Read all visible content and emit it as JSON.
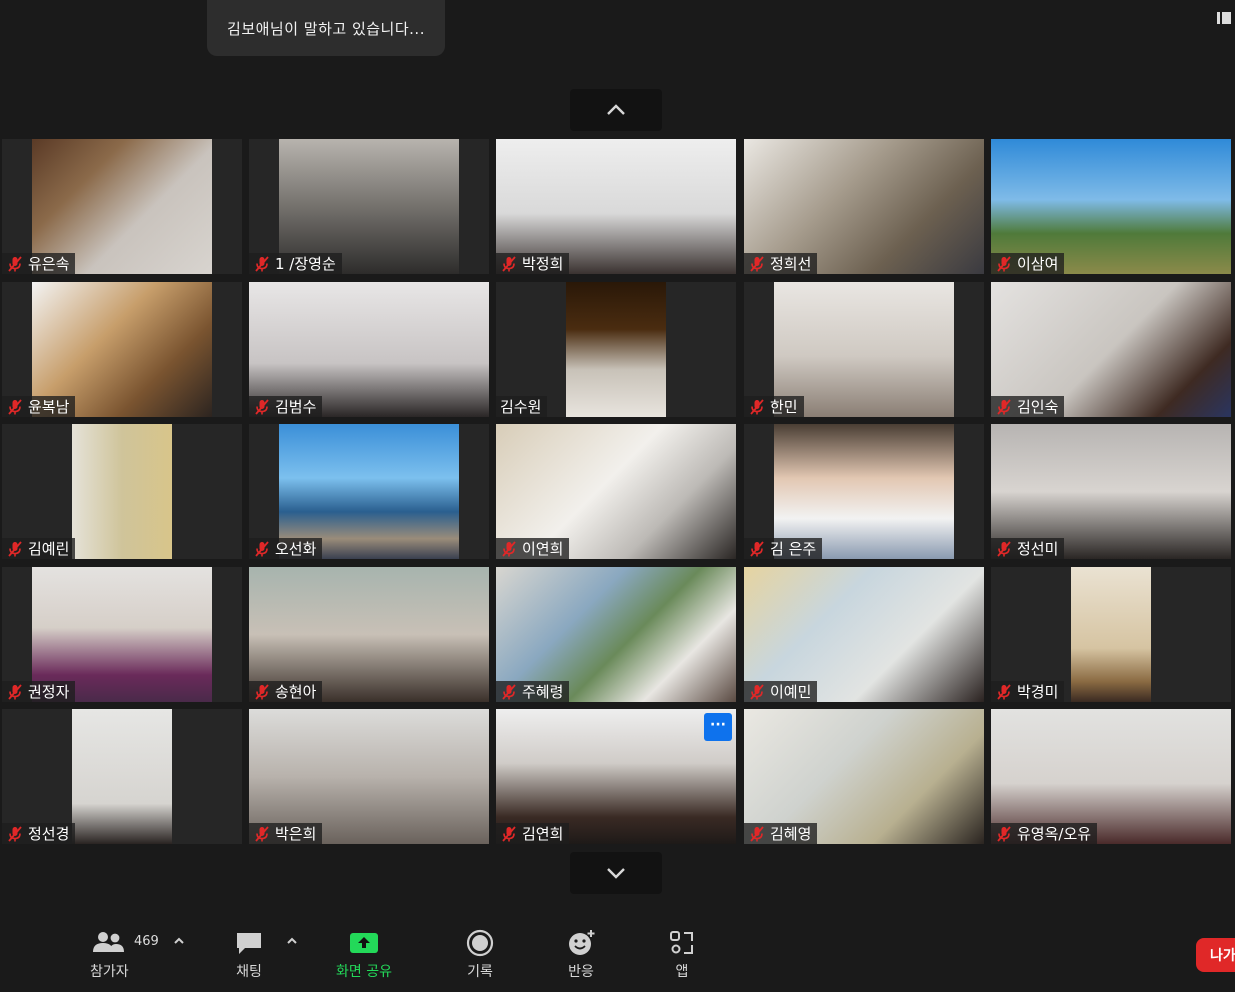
{
  "speaking_banner": "김보애님이 말하고 있습니다...",
  "participants": [
    {
      "name": "유은속",
      "bg": "linear-gradient(135deg,#5a3a26 0%,#8b6a4a 30%,#c9c3bd 60%,#d8d4cf 100%)"
    },
    {
      "name": "1 /장영순",
      "bg": "linear-gradient(180deg,#b8b4ae 0%,#6d6a66 55%,#2d2c2b 100%)"
    },
    {
      "name": "박정희",
      "bg": "linear-gradient(180deg,#eeeeee 0%,#d9d9d9 55%,#3a3230 100%)"
    },
    {
      "name": "정희선",
      "bg": "linear-gradient(135deg,#eae7e2 0%,#a59b8c 40%,#6c6050 70%,#3a3a40 100%)"
    },
    {
      "name": "이삼여",
      "bg": "linear-gradient(180deg,#2f8ad8 0%,#7fbbe8 45%,#4f7a3a 70%,#8b8a4a 100%)"
    },
    {
      "name": "윤복남",
      "bg": "linear-gradient(135deg,#f3f3f3 0%,#c79e6b 40%,#7a5430 70%,#2c2420 100%)"
    },
    {
      "name": "김범수",
      "bg": "linear-gradient(180deg,#e8e6e6 0%,#c8c4c4 60%,#2a2626 100%)"
    },
    {
      "name": "김수원",
      "bg": "linear-gradient(180deg,#2a1808 0%,#4a2c10 35%,#c8c2b8 65%,#e8e4de 100%)"
    },
    {
      "name": "한민",
      "bg": "linear-gradient(180deg,#e9e6e2 0%,#cfc9c2 55%,#8a7e74 100%)"
    },
    {
      "name": "김인숙",
      "bg": "linear-gradient(135deg,#e4e2e0 0%,#c9c5c0 50%,#3e2a22 80%,#2a3560 100%)"
    },
    {
      "name": "김예린",
      "bg": "linear-gradient(90deg,#e5e2d8 0%,#cfc49a 50%,#d8c58a 100%)"
    },
    {
      "name": "오선화",
      "bg": "linear-gradient(180deg,#3b8fd8 0%,#7cc0ee 40%,#2a5f8f 65%,#9a8c7a 85%,#3a4050 100%)"
    },
    {
      "name": "이연희",
      "bg": "linear-gradient(135deg,#d8cdb8 0%,#f2f0ec 45%,#bdbab6 70%,#2a2624 100%)"
    },
    {
      "name": "김 은주",
      "bg": "linear-gradient(180deg,#4a3e34 0%,#e2c7b2 40%,#f2f2f2 70%,#8a9ab0 100%)"
    },
    {
      "name": "정선미",
      "bg": "linear-gradient(180deg,#b7b4b2 0%,#d8d4d0 50%,#2a2624 100%)"
    },
    {
      "name": "권정자",
      "bg": "linear-gradient(180deg,#e4e2e0 0%,#d6cfc8 45%,#6a2a5a 80%,#4a2a4a 100%)"
    },
    {
      "name": "송현아",
      "bg": "linear-gradient(180deg,#a7b4ae 0%,#c8c0b6 50%,#3a302a 100%)"
    },
    {
      "name": "주혜령",
      "bg": "linear-gradient(135deg,#d8d6d0 0%,#8aa8c0 35%,#6a8a5a 55%,#e8e6e2 75%,#5a4a42 100%)"
    },
    {
      "name": "이예민",
      "bg": "linear-gradient(135deg,#e6d4a0 0%,#c8d6de 35%,#e2e4e2 65%,#2a2220 100%)"
    },
    {
      "name": "박경미",
      "bg": "linear-gradient(180deg,#eae2d2 0%,#d6c4a2 60%,#8a6a42 85%,#3a2a22 100%)"
    },
    {
      "name": "정선경",
      "bg": "linear-gradient(180deg,#e6e6e4 0%,#d6d4d0 70%,#2a2422 100%)"
    },
    {
      "name": "박은희",
      "bg": "linear-gradient(180deg,#dcdcda 0%,#b8b2ac 50%,#6a625c 100%)"
    },
    {
      "name": "김연희",
      "bg": "linear-gradient(180deg,#eeeeee 0%,#d0ccc8 40%,#3a2a24 80%,#1e1a18 100%)"
    },
    {
      "name": "김혜영",
      "bg": "linear-gradient(135deg,#eae8e2 0%,#cfd2ce 40%,#b8b090 70%,#2a2420 100%)"
    },
    {
      "name": "유영옥/오유",
      "bg": "linear-gradient(180deg,#e2e2e0 0%,#d6d2ce 55%,#4a2a2a 100%)"
    }
  ],
  "toolbar": {
    "participants": {
      "label": "참가자",
      "count": "469"
    },
    "chat": {
      "label": "채팅"
    },
    "share": {
      "label": "화면 공유",
      "color": "#23d959"
    },
    "record": {
      "label": "기록"
    },
    "reactions": {
      "label": "반응"
    },
    "apps": {
      "label": "앱"
    },
    "leave": {
      "label": "나가"
    }
  },
  "colors": {
    "background": "#1a1a1a",
    "tile": "#262626",
    "mute_red": "#e02828",
    "accent_blue": "#0e72ed"
  }
}
